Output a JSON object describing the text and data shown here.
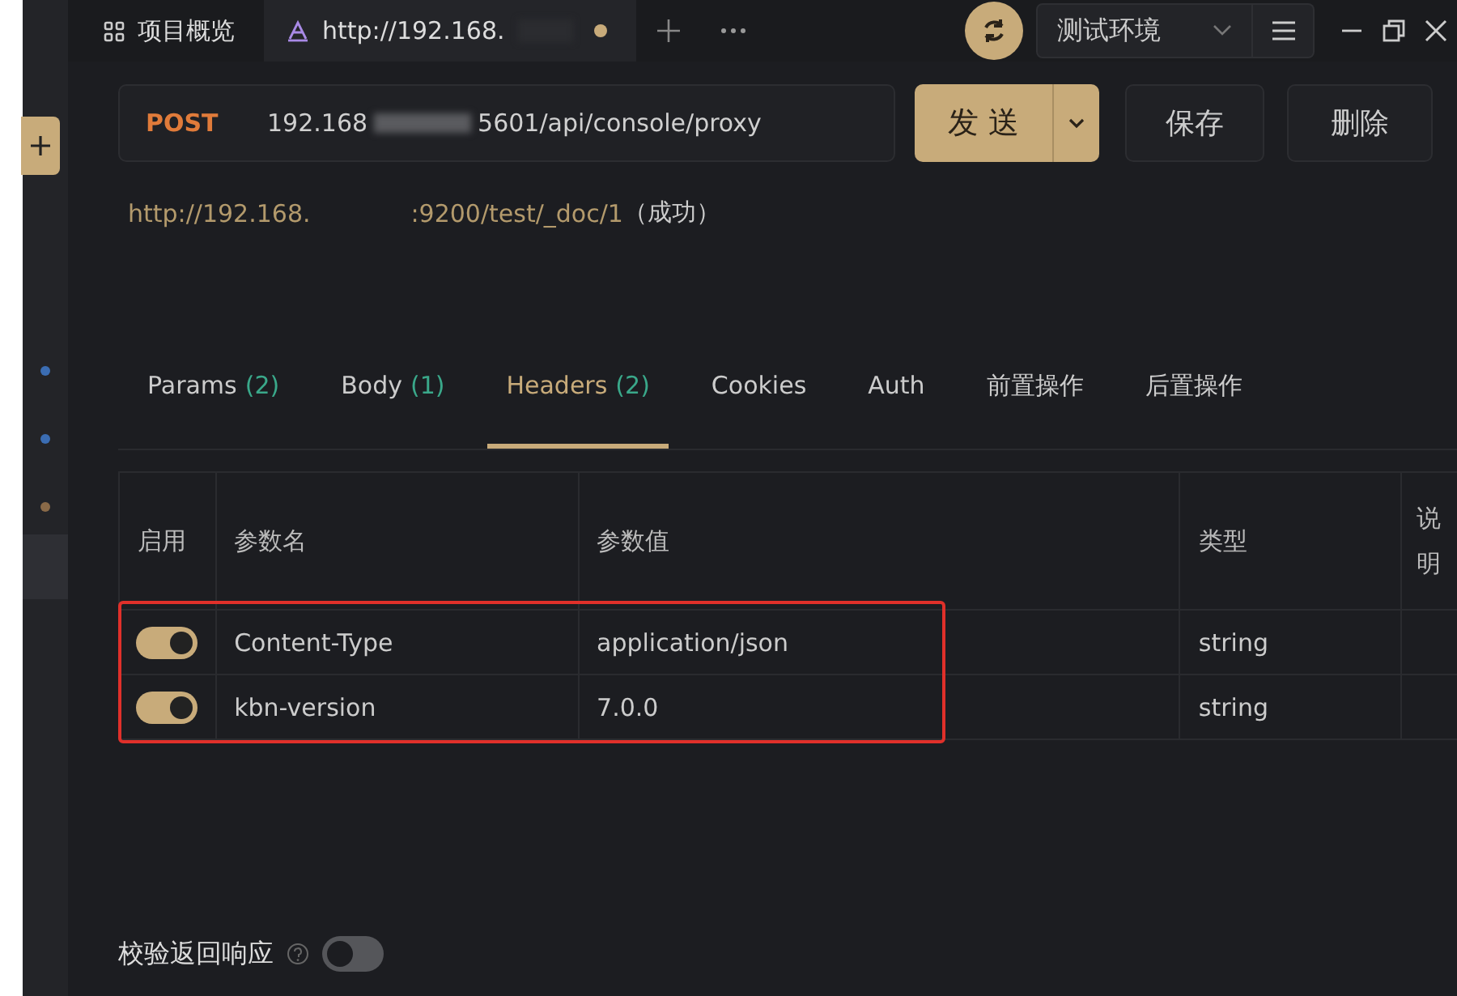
{
  "top_tabs": [
    {
      "kind": "overview",
      "label": "项目概览",
      "selected": false
    },
    {
      "kind": "request",
      "label": "http://192.168.",
      "selected": true,
      "unsaved": true
    }
  ],
  "environment": {
    "label": "测试环境"
  },
  "sidebar": {
    "dots": [
      {
        "color": "#3b6db3"
      },
      {
        "color": "#3b6db3"
      },
      {
        "color": "#8a6a48"
      }
    ]
  },
  "request": {
    "method": "POST",
    "url_start": "192.168",
    "url_end": "5601/api/console/proxy"
  },
  "buttons": {
    "send": "发送",
    "save": "保存",
    "delete": "删除"
  },
  "result": {
    "url_start": "http://192.168.",
    "url_end": ":9200/test/_doc/1",
    "status": "（成功）"
  },
  "tabs": [
    {
      "label": "Params",
      "count": "(2)",
      "selected": false
    },
    {
      "label": "Body",
      "count": "(1)",
      "selected": false
    },
    {
      "label": "Headers",
      "count": "(2)",
      "selected": true
    },
    {
      "label": "Cookies",
      "selected": false
    },
    {
      "label": "Auth",
      "selected": false
    },
    {
      "label": "前置操作",
      "selected": false
    },
    {
      "label": "后置操作",
      "selected": false
    }
  ],
  "table": {
    "columns": [
      "启用",
      "参数名",
      "参数值",
      "类型",
      "说明"
    ],
    "highlighted": true,
    "rows": [
      {
        "enabled": true,
        "name": "Content-Type",
        "value": "application/json",
        "type": "string"
      },
      {
        "enabled": true,
        "name": "kbn-version",
        "value": "7.0.0",
        "type": "string"
      }
    ]
  },
  "footer": {
    "label": "校验返回响应",
    "on": false
  }
}
